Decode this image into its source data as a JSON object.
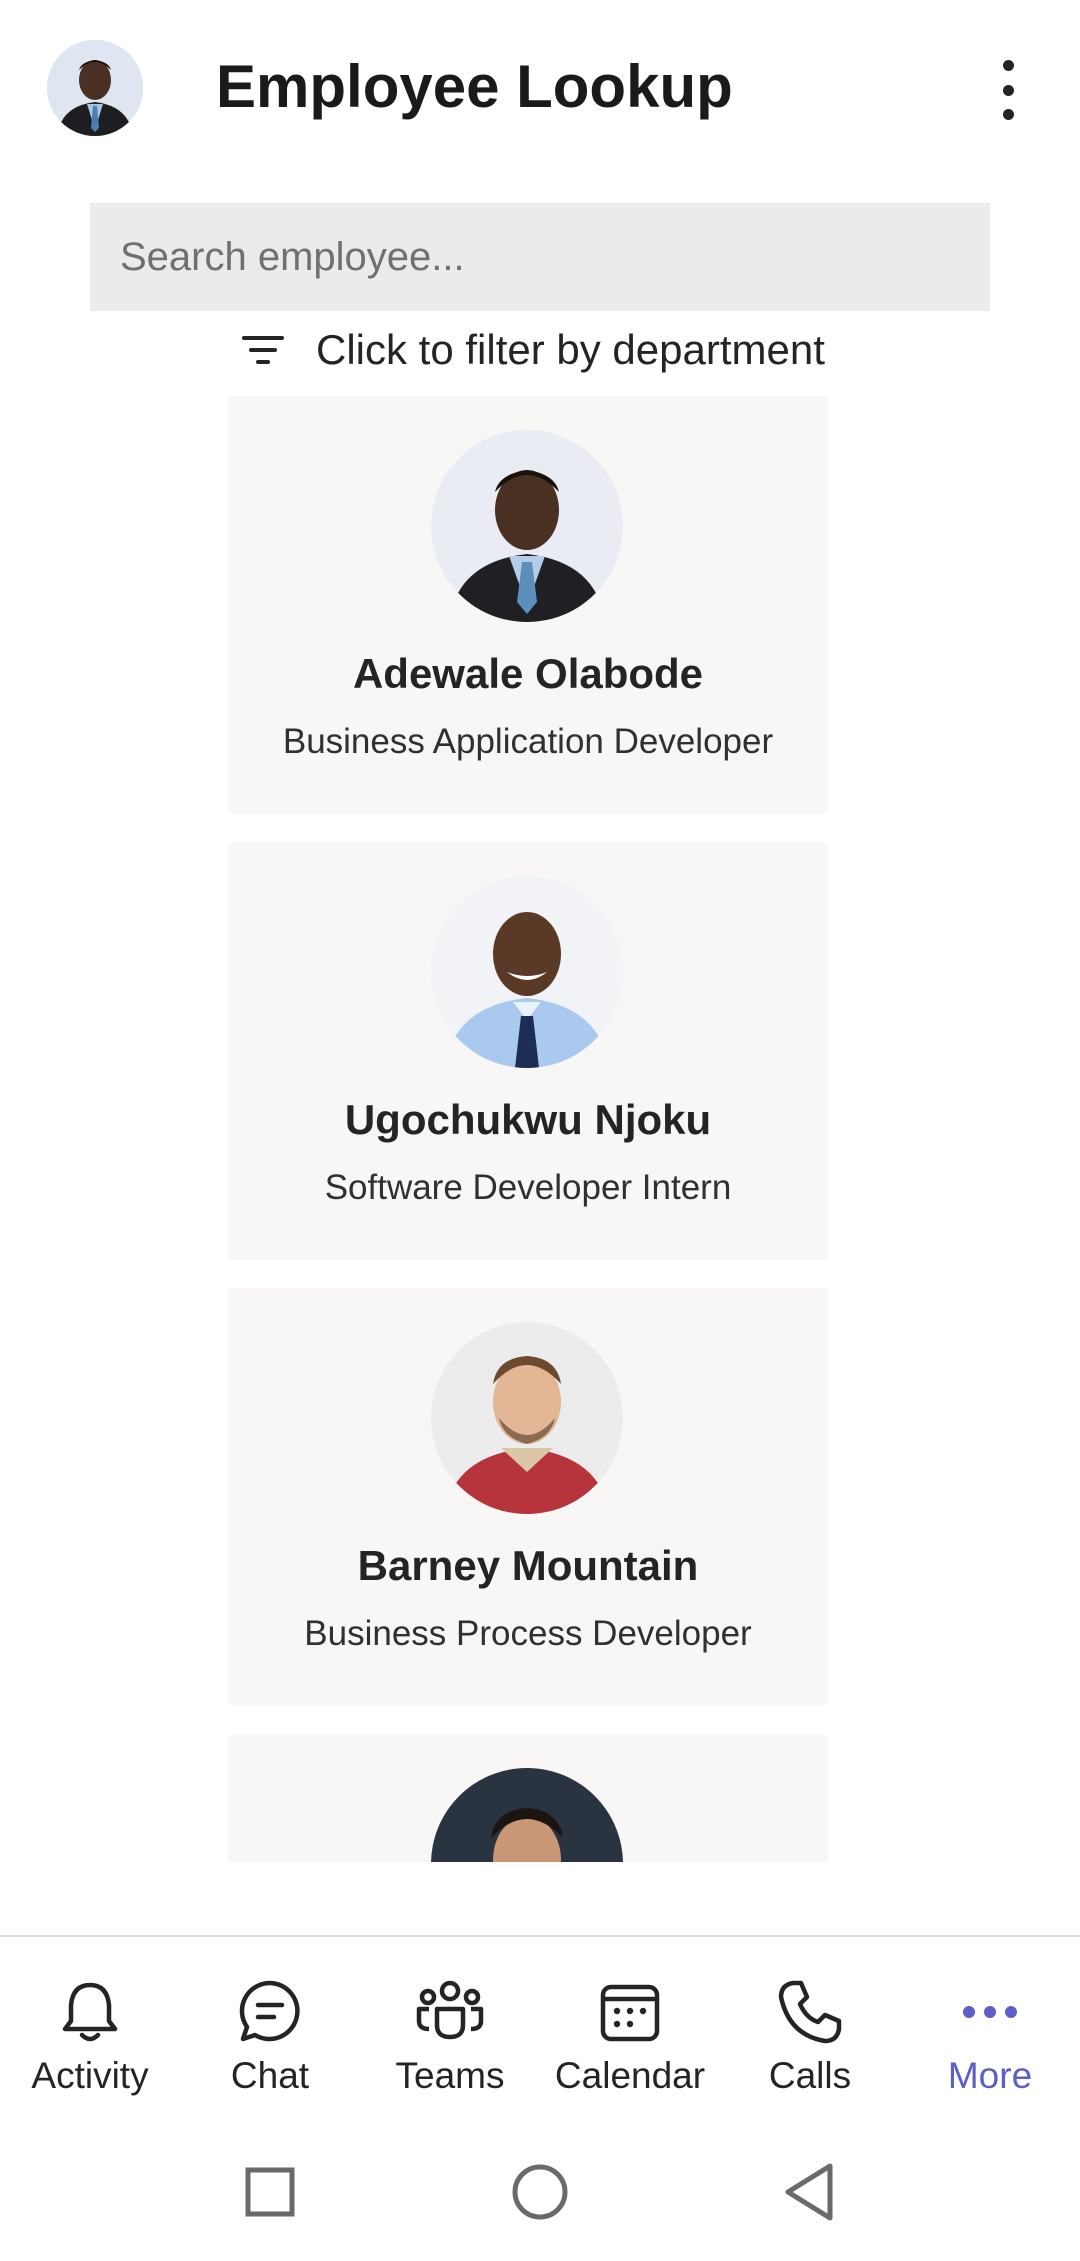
{
  "header": {
    "title": "Employee Lookup",
    "avatar_icon": "user-avatar"
  },
  "search": {
    "placeholder": "Search employee...",
    "value": ""
  },
  "filter": {
    "label": "Click to filter by department",
    "icon": "filter-icon"
  },
  "employees": [
    {
      "name": "Adewale Olabode",
      "title": "Business Application Developer"
    },
    {
      "name": "Ugochukwu Njoku",
      "title": "Software Developer Intern"
    },
    {
      "name": "Barney Mountain",
      "title": "Business Process Developer"
    },
    {
      "name": "",
      "title": ""
    }
  ],
  "bottom_nav": [
    {
      "label": "Activity",
      "icon": "bell-icon",
      "active": false
    },
    {
      "label": "Chat",
      "icon": "chat-icon",
      "active": false
    },
    {
      "label": "Teams",
      "icon": "teams-icon",
      "active": false
    },
    {
      "label": "Calendar",
      "icon": "calendar-icon",
      "active": false
    },
    {
      "label": "Calls",
      "icon": "phone-icon",
      "active": false
    },
    {
      "label": "More",
      "icon": "more-icon",
      "active": true
    }
  ],
  "colors": {
    "accent": "#5b5fc7",
    "card_bg": "#f8f7f6",
    "search_bg": "#ebebeb"
  }
}
